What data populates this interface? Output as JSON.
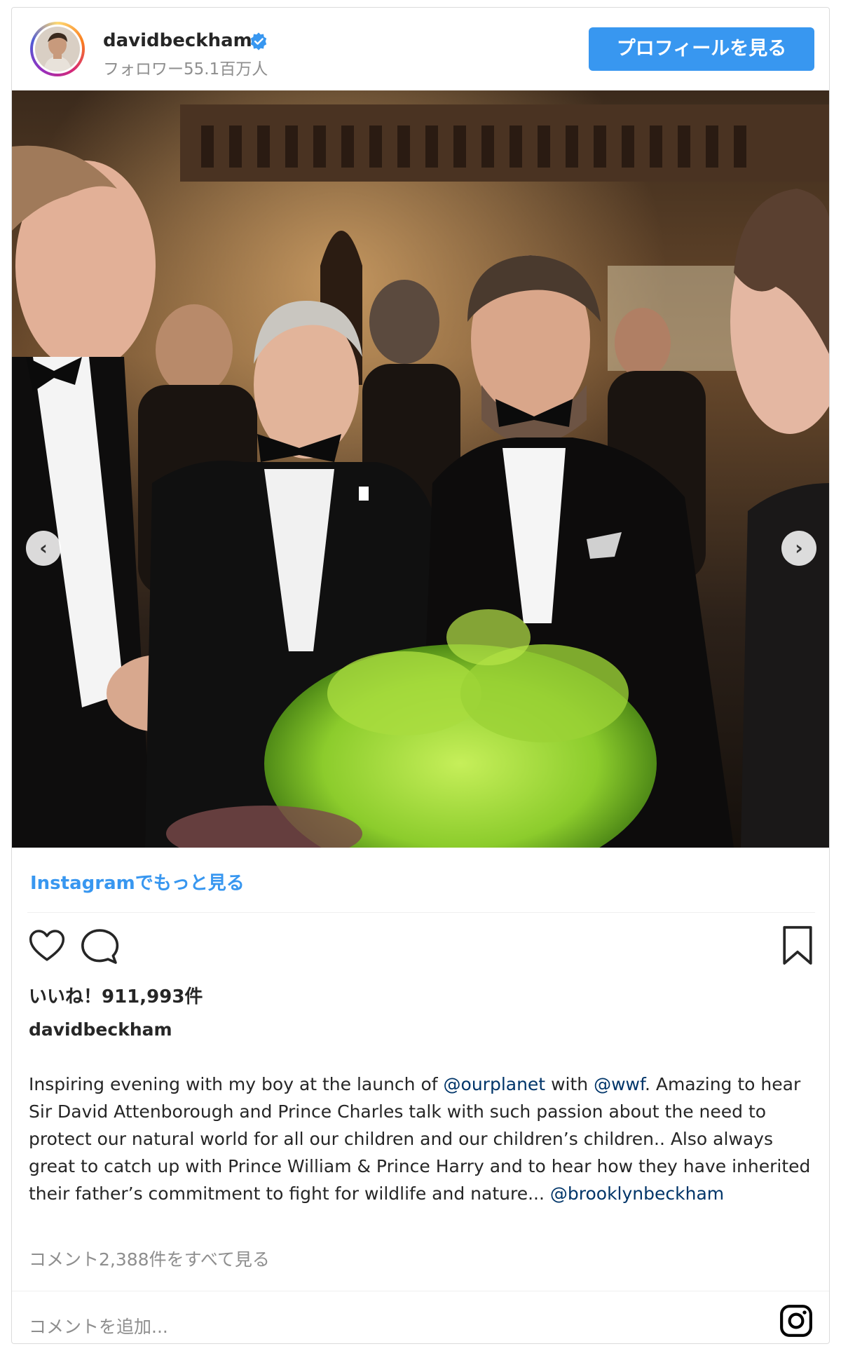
{
  "header": {
    "username": "davidbeckham",
    "followers": "フォロワー55.1百万人",
    "profile_button": "プロフィールを見る"
  },
  "post": {
    "image_alt": "",
    "prev_arrow": "‹",
    "next_arrow": "›",
    "more_on_instagram": "Instagramでもっと見る",
    "likes": "いいね！911,993件",
    "caption_user": "davidbeckham",
    "caption_parts": {
      "p1": "Inspiring evening with my boy at the launch of ",
      "m1": "@ourplanet",
      "p2": " with ",
      "m2": "@wwf",
      "p3": ". Amazing to hear Sir David Attenborough and Prince Charles talk with such passion about the need to protect our natural world for all our children and our children’s children.. Also always great to catch up with Prince William & Prince Harry and to hear how they have inherited their father’s commitment to fight for wildlife and nature... ",
      "m3": "@brooklynbeckham"
    },
    "view_comments": "コメント2,388件をすべて見る",
    "add_comment_placeholder": "コメントを追加..."
  },
  "icons": {
    "verified": "verified-badge-icon",
    "like": "heart-icon",
    "comment": "speech-bubble-icon",
    "save": "bookmark-icon",
    "instagram": "instagram-logo-icon"
  },
  "colors": {
    "accent": "#3897f0",
    "mention": "#003569",
    "muted": "#8e8e8e"
  }
}
